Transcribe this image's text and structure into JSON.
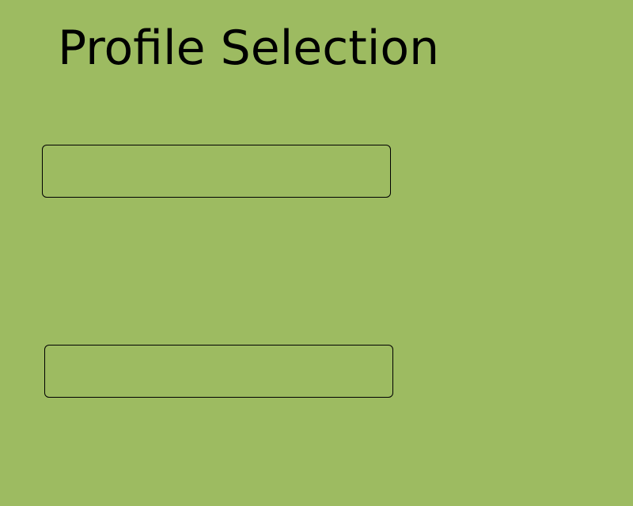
{
  "page": {
    "title": "Profile Selection",
    "background_color": "#9dbb61"
  },
  "profiles": [
    {
      "label": ""
    },
    {
      "label": ""
    }
  ]
}
